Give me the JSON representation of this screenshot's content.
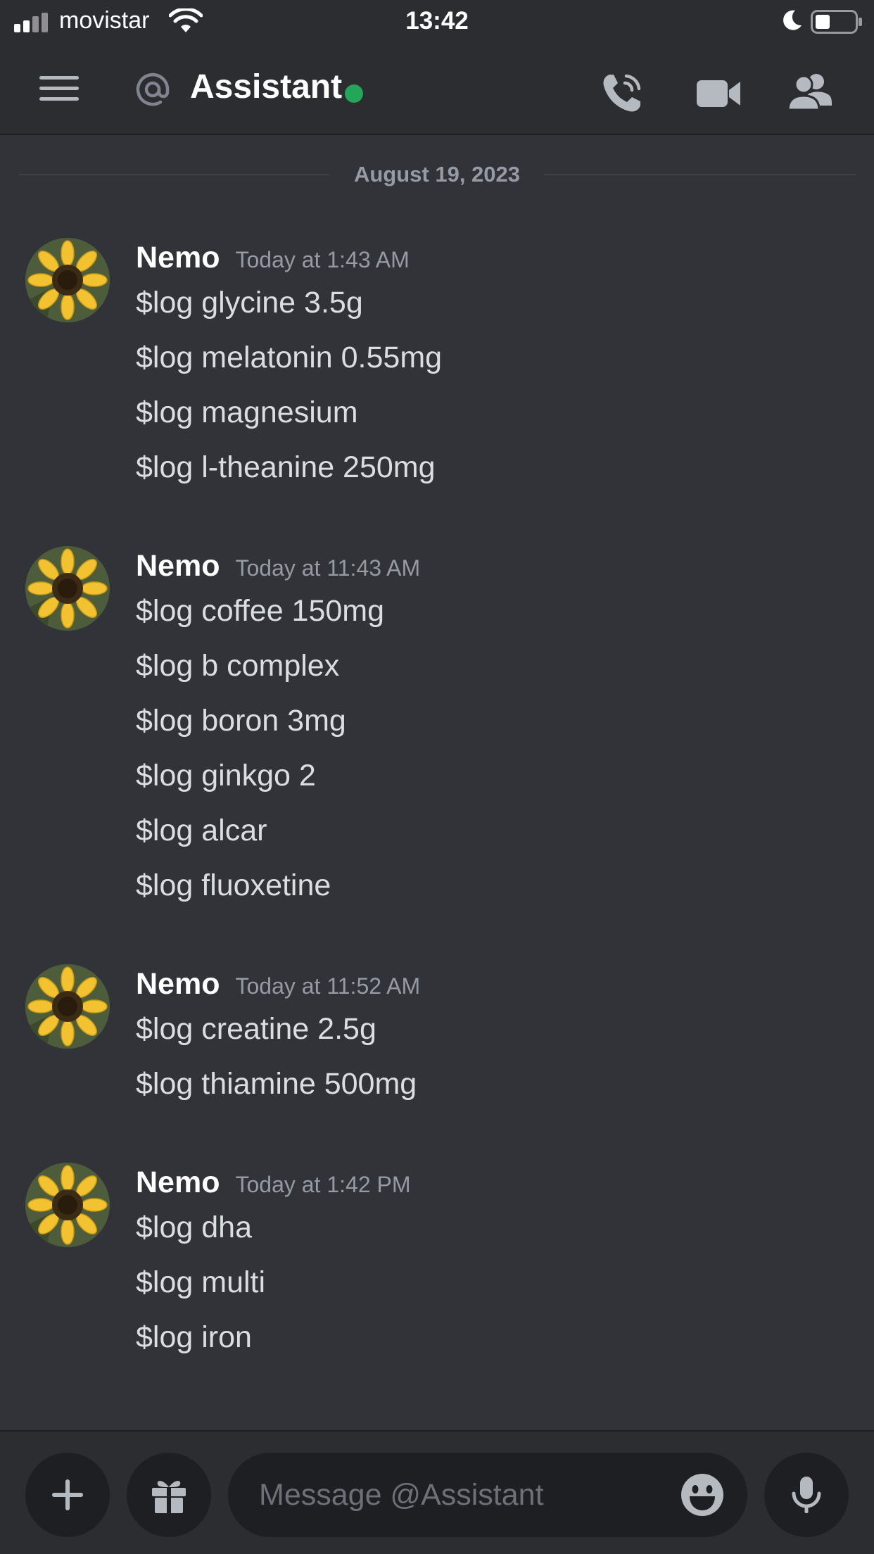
{
  "status_bar": {
    "carrier": "movistar",
    "time": "13:42"
  },
  "header": {
    "title": "Assistant",
    "presence": "online"
  },
  "date_divider": "August 19, 2023",
  "messages": [
    {
      "author": "Nemo",
      "timestamp": "Today at 1:43 AM",
      "lines": [
        "$log glycine 3.5g",
        "$log melatonin 0.55mg",
        "$log magnesium",
        "$log l-theanine 250mg"
      ]
    },
    {
      "author": "Nemo",
      "timestamp": "Today at 11:43 AM",
      "lines": [
        "$log coffee 150mg",
        "$log b complex",
        "$log boron 3mg",
        "$log ginkgo 2",
        "$log alcar",
        "$log fluoxetine"
      ]
    },
    {
      "author": "Nemo",
      "timestamp": "Today at 11:52 AM",
      "lines": [
        "$log creatine 2.5g",
        "$log thiamine 500mg"
      ]
    },
    {
      "author": "Nemo",
      "timestamp": "Today at 1:42 PM",
      "lines": [
        "$log dha",
        "$log multi",
        "$log iron"
      ]
    }
  ],
  "composer": {
    "placeholder": "Message @Assistant"
  },
  "icons": {
    "menu": "menu-icon",
    "at": "at-icon",
    "call": "phone-call-icon",
    "video": "video-camera-icon",
    "members": "members-icon",
    "plus": "plus-icon",
    "gift": "gift-icon",
    "emoji": "emoji-icon",
    "mic": "microphone-icon"
  },
  "colors": {
    "background": "#313338",
    "header": "#2b2d31",
    "online": "#23a55a",
    "muted_text": "#949ba4"
  }
}
